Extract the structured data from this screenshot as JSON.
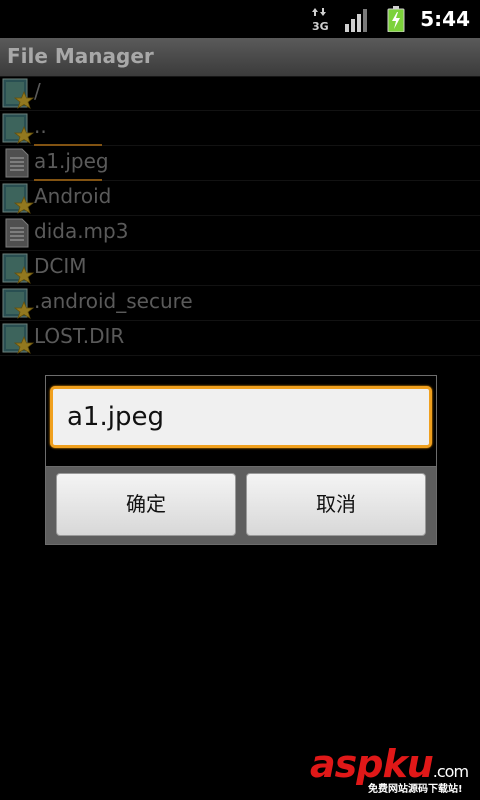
{
  "status_bar": {
    "time": "5:44",
    "network_icon": "3g-data-icon",
    "signal_icon": "signal-strength-icon",
    "battery_icon": "battery-charging-icon",
    "battery_color": "#7cd23a"
  },
  "title_bar": {
    "title": "File Manager"
  },
  "file_list": {
    "items": [
      {
        "name": "/",
        "type": "folder",
        "icon": "folder-star-icon"
      },
      {
        "name": "..",
        "type": "folder",
        "icon": "folder-star-icon"
      },
      {
        "name": "a1.jpeg",
        "type": "file",
        "icon": "document-icon"
      },
      {
        "name": "Android",
        "type": "folder",
        "icon": "folder-star-icon"
      },
      {
        "name": "dida.mp3",
        "type": "file",
        "icon": "document-icon"
      },
      {
        "name": "DCIM",
        "type": "folder",
        "icon": "folder-star-icon"
      },
      {
        "name": ".android_secure",
        "type": "folder",
        "icon": "folder-star-icon"
      },
      {
        "name": "LOST.DIR",
        "type": "folder",
        "icon": "folder-star-icon"
      }
    ]
  },
  "dialog": {
    "input_value": "a1.jpeg",
    "ok_label": "确定",
    "cancel_label": "取消",
    "accent_color": "#f0a01e"
  },
  "watermark": {
    "logo_red": "aspku",
    "logo_suffix": ".com",
    "tagline": "免费网站源码下载站!"
  }
}
